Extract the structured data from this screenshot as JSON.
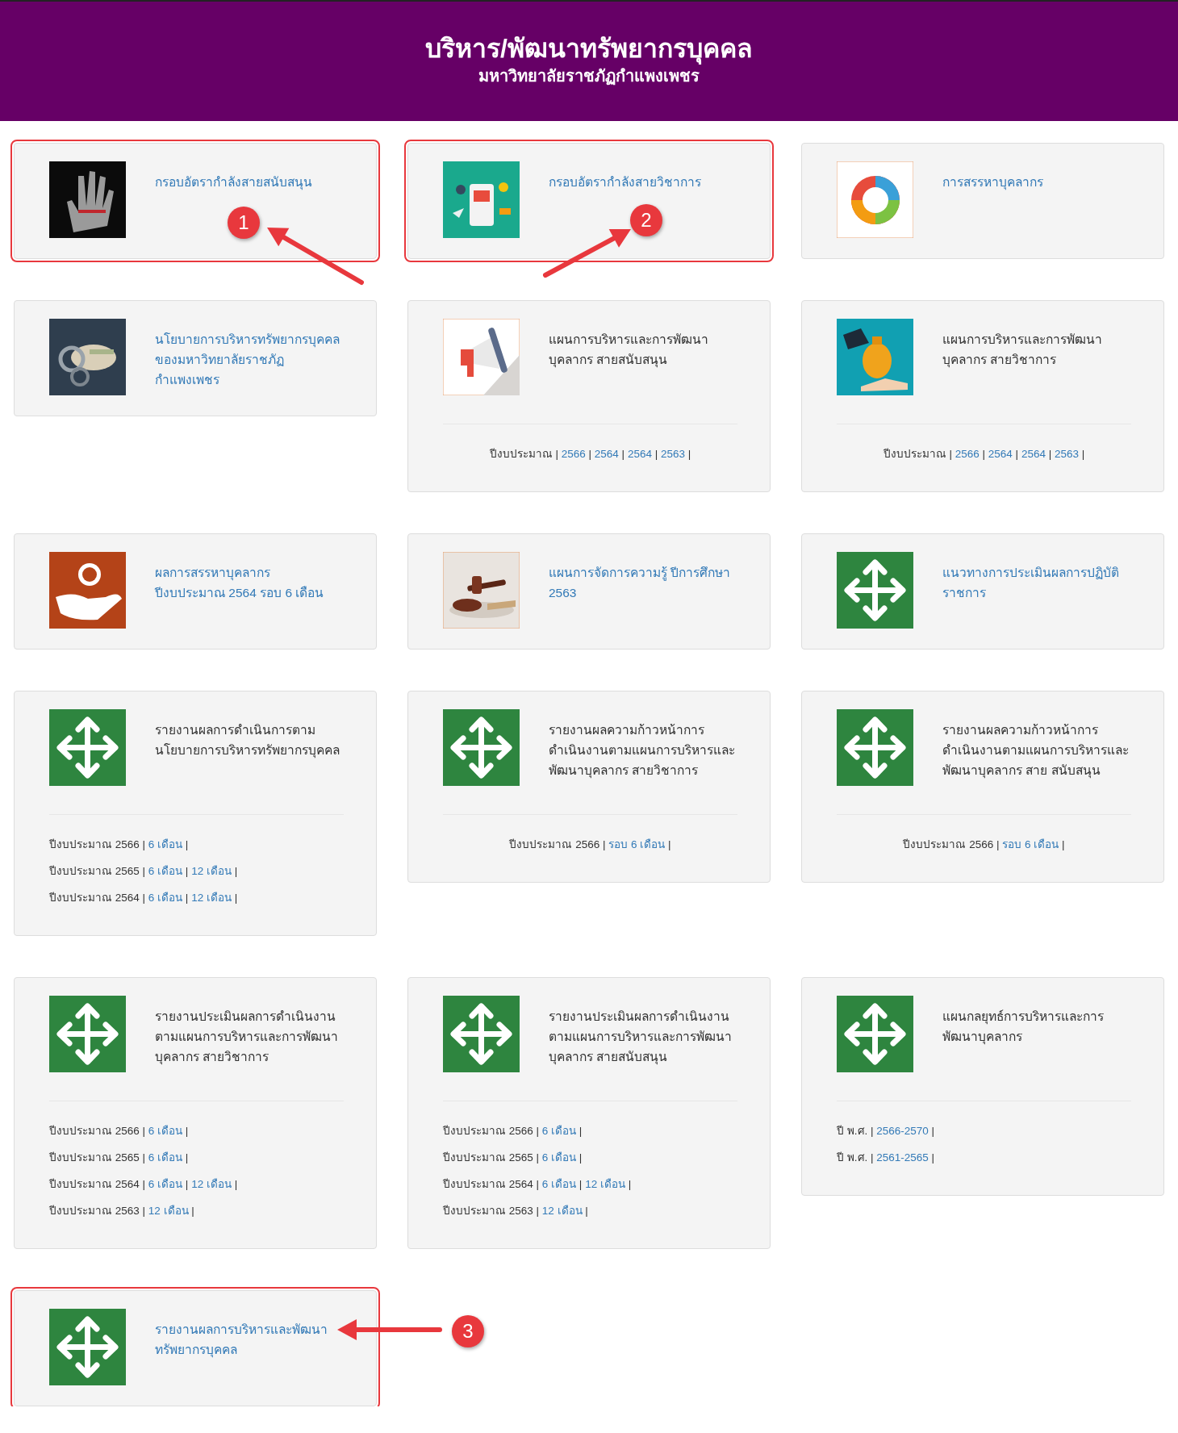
{
  "header": {
    "title": "บริหาร/พัฒนาทรัพยากรบุคคล",
    "subtitle": "มหาวิทยาลัยราชภัฏกำแพงเพชร"
  },
  "cards": [
    {
      "title": "กรอบอัตรากำลังสายสนับสนุน",
      "linked": true,
      "kind": "picture",
      "highlighted": true,
      "marker": "1"
    },
    {
      "title": "กรอบอัตรากำลังสายวิชาการ",
      "linked": true,
      "kind": "picture",
      "highlighted": true,
      "marker": "2"
    },
    {
      "title": "การสรรหาบุคลากร",
      "linked": true,
      "kind": "picture",
      "highlighted": false
    },
    {
      "title": "นโยบายการบริหารทรัพยากรบุคคลของมหาวิทยาลัยราชภัฏกำแพงเพชร",
      "linked": true,
      "kind": "picture",
      "highlighted": false
    },
    {
      "title": "แผนการบริหารและการพัฒนา บุคลากร สายสนับสนุน",
      "linked": false,
      "kind": "picture",
      "highlighted": false,
      "centered": true,
      "lines": [
        [
          {
            "text": "ปีงบประมาณ |",
            "link": false
          },
          {
            "text": "2566",
            "link": true
          },
          {
            "text": "|",
            "link": false
          },
          {
            "text": "2564",
            "link": true
          },
          {
            "text": "|",
            "link": false
          },
          {
            "text": "2564",
            "link": true
          },
          {
            "text": "|",
            "link": false
          },
          {
            "text": "2563",
            "link": true
          },
          {
            "text": "|",
            "link": false
          }
        ]
      ]
    },
    {
      "title": "แผนการบริหารและการพัฒนา บุคลากร สายวิชาการ",
      "linked": false,
      "kind": "picture",
      "highlighted": false,
      "centered": true,
      "lines": [
        [
          {
            "text": "ปีงบประมาณ |",
            "link": false
          },
          {
            "text": "2566",
            "link": true
          },
          {
            "text": "|",
            "link": false
          },
          {
            "text": "2564",
            "link": true
          },
          {
            "text": "|",
            "link": false
          },
          {
            "text": "2564",
            "link": true
          },
          {
            "text": "|",
            "link": false
          },
          {
            "text": "2563",
            "link": true
          },
          {
            "text": "|",
            "link": false
          }
        ]
      ]
    },
    {
      "title": "ผลการสรรหาบุคลากร ปีงบประมาณ 2564 รอบ 6 เดือน",
      "linked": true,
      "kind": "picture",
      "highlighted": false
    },
    {
      "title": "แผนการจัดการความรู้ ปีการศึกษา 2563",
      "linked": true,
      "kind": "picture",
      "highlighted": false
    },
    {
      "title": "แนวทางการประเมินผลการปฏิบัติราชการ",
      "linked": true,
      "kind": "move",
      "highlighted": false
    },
    {
      "title": "รายงานผลการดำเนินการตามนโยบายการบริหารทรัพยากรบุคคล",
      "linked": false,
      "kind": "move",
      "highlighted": false,
      "centered": false,
      "lines": [
        [
          {
            "text": "ปีงบประมาณ 2566 |",
            "link": false
          },
          {
            "text": "6 เดือน",
            "link": true
          },
          {
            "text": "|",
            "link": false
          }
        ],
        [
          {
            "text": "ปีงบประมาณ 2565 |",
            "link": false
          },
          {
            "text": "6 เดือน",
            "link": true
          },
          {
            "text": "|",
            "link": false
          },
          {
            "text": "12 เดือน",
            "link": true
          },
          {
            "text": "|",
            "link": false
          }
        ],
        [
          {
            "text": "ปีงบประมาณ 2564 |",
            "link": false
          },
          {
            "text": "6 เดือน",
            "link": true
          },
          {
            "text": "|",
            "link": false
          },
          {
            "text": "12 เดือน",
            "link": true
          },
          {
            "text": "|",
            "link": false
          }
        ]
      ]
    },
    {
      "title": "รายงานผลความก้าวหน้าการดำเนินงานตามแผนการบริหารและพัฒนาบุคลากร สายวิชาการ",
      "linked": false,
      "kind": "move",
      "highlighted": false,
      "centered": true,
      "lines": [
        [
          {
            "text": "ปีงบประมาณ 2566 |",
            "link": false
          },
          {
            "text": "รอบ 6 เดือน",
            "link": true
          },
          {
            "text": "|",
            "link": false
          }
        ]
      ]
    },
    {
      "title": "รายงานผลความก้าวหน้าการดำเนินงานตามแผนการบริหารและพัฒนาบุคลากร สาย สนับสนุน",
      "linked": false,
      "kind": "move",
      "highlighted": false,
      "centered": true,
      "lines": [
        [
          {
            "text": "ปีงบประมาณ 2566 |",
            "link": false
          },
          {
            "text": "รอบ 6 เดือน",
            "link": true
          },
          {
            "text": "|",
            "link": false
          }
        ]
      ]
    },
    {
      "title": "รายงานประเมินผลการดำเนินงานตามแผนการบริหารและการพัฒนาบุคลากร สายวิชาการ",
      "linked": false,
      "kind": "move",
      "highlighted": false,
      "centered": false,
      "lines": [
        [
          {
            "text": "ปีงบประมาณ 2566 |",
            "link": false
          },
          {
            "text": "6 เดือน",
            "link": true
          },
          {
            "text": "|",
            "link": false
          }
        ],
        [
          {
            "text": "ปีงบประมาณ 2565 |",
            "link": false
          },
          {
            "text": "6 เดือน",
            "link": true
          },
          {
            "text": "|",
            "link": false
          }
        ],
        [
          {
            "text": "ปีงบประมาณ 2564 |",
            "link": false
          },
          {
            "text": "6 เดือน",
            "link": true
          },
          {
            "text": "|",
            "link": false
          },
          {
            "text": "12 เดือน",
            "link": true
          },
          {
            "text": "|",
            "link": false
          }
        ],
        [
          {
            "text": "ปีงบประมาณ 2563 |",
            "link": false
          },
          {
            "text": "12 เดือน",
            "link": true
          },
          {
            "text": "|",
            "link": false
          }
        ]
      ]
    },
    {
      "title": "รายงานประเมินผลการดำเนินงานตามแผนการบริหารและการพัฒนาบุคลากร สายสนับสนุน",
      "linked": false,
      "kind": "move",
      "highlighted": false,
      "centered": false,
      "lines": [
        [
          {
            "text": "ปีงบประมาณ 2566 |",
            "link": false
          },
          {
            "text": "6 เดือน",
            "link": true
          },
          {
            "text": "|",
            "link": false
          }
        ],
        [
          {
            "text": "ปีงบประมาณ 2565 |",
            "link": false
          },
          {
            "text": "6 เดือน",
            "link": true
          },
          {
            "text": "|",
            "link": false
          }
        ],
        [
          {
            "text": "ปีงบประมาณ 2564 |",
            "link": false
          },
          {
            "text": "6 เดือน",
            "link": true
          },
          {
            "text": "|",
            "link": false
          },
          {
            "text": "12 เดือน",
            "link": true
          },
          {
            "text": "|",
            "link": false
          }
        ],
        [
          {
            "text": "ปีงบประมาณ 2563 |",
            "link": false
          },
          {
            "text": "12 เดือน",
            "link": true
          },
          {
            "text": "|",
            "link": false
          }
        ]
      ]
    },
    {
      "title": "แผนกลยุทธ์การบริหารและการพัฒนาบุคลากร",
      "linked": false,
      "kind": "move",
      "highlighted": false,
      "centered": false,
      "lines": [
        [
          {
            "text": "ปี พ.ศ. |",
            "link": false
          },
          {
            "text": "2566-2570",
            "link": true
          },
          {
            "text": "|",
            "link": false
          }
        ],
        [
          {
            "text": "ปี พ.ศ. |",
            "link": false
          },
          {
            "text": "2561-2565",
            "link": true
          },
          {
            "text": "|",
            "link": false
          }
        ]
      ]
    },
    {
      "title": "รายงานผลการบริหารและพัฒนาทรัพยากรบุคคล",
      "linked": true,
      "kind": "move",
      "highlighted": true,
      "marker": "3"
    }
  ]
}
